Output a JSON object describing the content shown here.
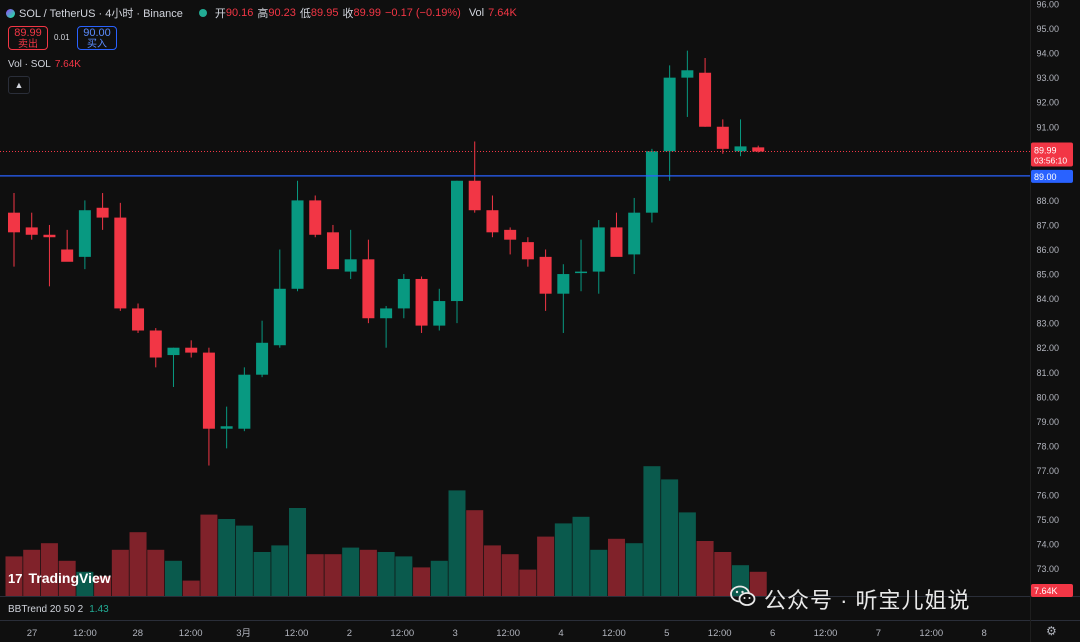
{
  "header": {
    "symbol": "SOL / TetherUS · 4小时 · Binance",
    "open_label": "开",
    "open": "90.16",
    "high_label": "高",
    "high": "90.23",
    "low_label": "低",
    "low": "89.95",
    "close_label": "收",
    "close": "89.99",
    "change": "−0.17 (−0.19%)",
    "vol_label": "Vol",
    "vol": "7.64K"
  },
  "trade": {
    "sell_price": "89.99",
    "sell_label": "卖出",
    "spread": "0.01",
    "buy_price": "90.00",
    "buy_label": "买入"
  },
  "volume_legend": {
    "label": "Vol · SOL",
    "value": "7.64K"
  },
  "collapse_icon": "chevron-up-icon",
  "indicator": {
    "name": "BBTrend 20 50 2",
    "value": "1.43"
  },
  "brand": {
    "name": "TradingView",
    "icon": "tradingview-logo-icon"
  },
  "watermark": {
    "icon": "wechat-icon",
    "text": "公众号 · 听宝儿姐说"
  },
  "settings_icon": "gear-icon",
  "colors": {
    "up": "#089981",
    "down": "#f23645",
    "hline": "#2962ff",
    "bg": "#0f0f0f"
  },
  "chart_data": {
    "type": "candlestick",
    "ylim": [
      72.5,
      96.0
    ],
    "yticks": [
      73,
      74,
      75,
      76,
      77,
      78,
      79,
      80,
      81,
      82,
      83,
      84,
      85,
      86,
      87,
      88,
      89,
      90,
      91,
      92,
      93,
      94,
      95,
      96
    ],
    "xticks": [
      "27",
      "12:00",
      "28",
      "12:00",
      "3月",
      "12:00",
      "2",
      "12:00",
      "3",
      "12:00",
      "4",
      "12:00",
      "5",
      "12:00",
      "6",
      "12:00",
      "7",
      "12:00",
      "8"
    ],
    "grid": false,
    "price_label": {
      "price": "89.99",
      "countdown": "03:56:10"
    },
    "hline": {
      "price": "89.00",
      "label": "89.00"
    },
    "volume_label": "7.64K",
    "candles": [
      {
        "o": 87.5,
        "h": 88.3,
        "l": 85.3,
        "c": 86.7,
        "v": 1.8
      },
      {
        "o": 86.9,
        "h": 87.5,
        "l": 86.4,
        "c": 86.6,
        "v": 2.1
      },
      {
        "o": 86.6,
        "h": 87.0,
        "l": 84.5,
        "c": 86.5,
        "v": 2.4
      },
      {
        "o": 86.0,
        "h": 86.8,
        "l": 85.6,
        "c": 85.5,
        "v": 1.6
      },
      {
        "o": 85.7,
        "h": 88.0,
        "l": 85.2,
        "c": 87.6,
        "v": 1.1
      },
      {
        "o": 87.7,
        "h": 88.3,
        "l": 86.8,
        "c": 87.3,
        "v": 0.9
      },
      {
        "o": 87.3,
        "h": 87.9,
        "l": 83.5,
        "c": 83.6,
        "v": 2.1
      },
      {
        "o": 83.6,
        "h": 83.8,
        "l": 82.6,
        "c": 82.7,
        "v": 2.9
      },
      {
        "o": 82.7,
        "h": 82.8,
        "l": 81.2,
        "c": 81.6,
        "v": 2.1
      },
      {
        "o": 81.7,
        "h": 82.0,
        "l": 80.4,
        "c": 82.0,
        "v": 1.6
      },
      {
        "o": 82.0,
        "h": 82.3,
        "l": 81.6,
        "c": 81.8,
        "v": 0.7
      },
      {
        "o": 81.8,
        "h": 82.0,
        "l": 77.2,
        "c": 78.7,
        "v": 3.7
      },
      {
        "o": 78.7,
        "h": 79.6,
        "l": 77.9,
        "c": 78.8,
        "v": 3.5
      },
      {
        "o": 78.7,
        "h": 81.2,
        "l": 78.6,
        "c": 80.9,
        "v": 3.2
      },
      {
        "o": 80.9,
        "h": 83.1,
        "l": 80.8,
        "c": 82.2,
        "v": 2.0
      },
      {
        "o": 82.1,
        "h": 86.0,
        "l": 82.0,
        "c": 84.4,
        "v": 2.3
      },
      {
        "o": 84.4,
        "h": 88.8,
        "l": 84.3,
        "c": 88.0,
        "v": 4.0
      },
      {
        "o": 88.0,
        "h": 88.2,
        "l": 86.5,
        "c": 86.6,
        "v": 1.9
      },
      {
        "o": 86.7,
        "h": 87.0,
        "l": 85.3,
        "c": 85.2,
        "v": 1.9
      },
      {
        "o": 85.1,
        "h": 86.8,
        "l": 84.8,
        "c": 85.6,
        "v": 2.2
      },
      {
        "o": 85.6,
        "h": 86.4,
        "l": 83.0,
        "c": 83.2,
        "v": 2.1
      },
      {
        "o": 83.2,
        "h": 83.7,
        "l": 82.0,
        "c": 83.6,
        "v": 2.0
      },
      {
        "o": 83.6,
        "h": 85.0,
        "l": 83.2,
        "c": 84.8,
        "v": 1.8
      },
      {
        "o": 84.8,
        "h": 84.9,
        "l": 82.6,
        "c": 82.9,
        "v": 1.3
      },
      {
        "o": 82.9,
        "h": 84.4,
        "l": 82.7,
        "c": 83.9,
        "v": 1.6
      },
      {
        "o": 83.9,
        "h": 88.8,
        "l": 83.0,
        "c": 88.8,
        "v": 4.8
      },
      {
        "o": 88.8,
        "h": 90.4,
        "l": 87.5,
        "c": 87.6,
        "v": 3.9
      },
      {
        "o": 87.6,
        "h": 88.2,
        "l": 86.5,
        "c": 86.7,
        "v": 2.3
      },
      {
        "o": 86.8,
        "h": 86.9,
        "l": 85.8,
        "c": 86.4,
        "v": 1.9
      },
      {
        "o": 86.3,
        "h": 86.5,
        "l": 85.3,
        "c": 85.6,
        "v": 1.2
      },
      {
        "o": 85.7,
        "h": 86.0,
        "l": 83.5,
        "c": 84.2,
        "v": 2.7
      },
      {
        "o": 84.2,
        "h": 85.4,
        "l": 82.6,
        "c": 85.0,
        "v": 3.3
      },
      {
        "o": 85.1,
        "h": 86.4,
        "l": 84.3,
        "c": 85.1,
        "v": 3.6
      },
      {
        "o": 85.1,
        "h": 87.2,
        "l": 84.2,
        "c": 86.9,
        "v": 2.1
      },
      {
        "o": 86.9,
        "h": 87.5,
        "l": 85.8,
        "c": 85.7,
        "v": 2.6
      },
      {
        "o": 85.8,
        "h": 88.1,
        "l": 85.0,
        "c": 87.5,
        "v": 2.4
      },
      {
        "o": 87.5,
        "h": 90.1,
        "l": 87.1,
        "c": 90.0,
        "v": 5.9
      },
      {
        "o": 90.0,
        "h": 93.5,
        "l": 88.8,
        "c": 93.0,
        "v": 5.3
      },
      {
        "o": 93.0,
        "h": 94.1,
        "l": 91.4,
        "c": 93.3,
        "v": 3.8
      },
      {
        "o": 93.2,
        "h": 93.8,
        "l": 91.0,
        "c": 91.0,
        "v": 2.5
      },
      {
        "o": 91.0,
        "h": 91.3,
        "l": 89.9,
        "c": 90.1,
        "v": 2.0
      },
      {
        "o": 90.0,
        "h": 91.3,
        "l": 89.8,
        "c": 90.2,
        "v": 1.4
      },
      {
        "o": 90.16,
        "h": 90.23,
        "l": 89.95,
        "c": 89.99,
        "v": 1.1
      }
    ]
  }
}
